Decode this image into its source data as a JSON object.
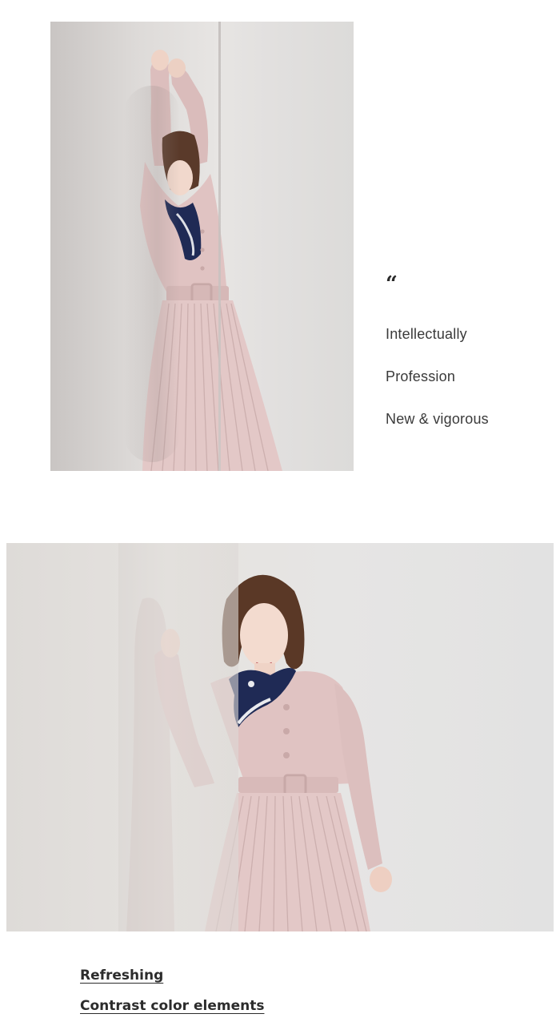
{
  "photos": [
    {
      "name": "photo-woman-arms-raised-against-wall",
      "colors": {
        "dress": "#e2c7c6",
        "scarf": "#1f2a55",
        "hair": "#5a3a2a",
        "wall": "#e3e1df"
      }
    },
    {
      "name": "photo-woman-leaning-on-wall",
      "colors": {
        "dress": "#dfc4c3",
        "scarf": "#1f2a55",
        "hair": "#5a3826",
        "wall": "#e4e2e0"
      }
    }
  ],
  "quote": {
    "mark": "“",
    "lines": [
      "Intellectually",
      "Profession",
      "New & vigorous"
    ]
  },
  "captions": [
    "Refreshing",
    "Contrast color elements"
  ]
}
